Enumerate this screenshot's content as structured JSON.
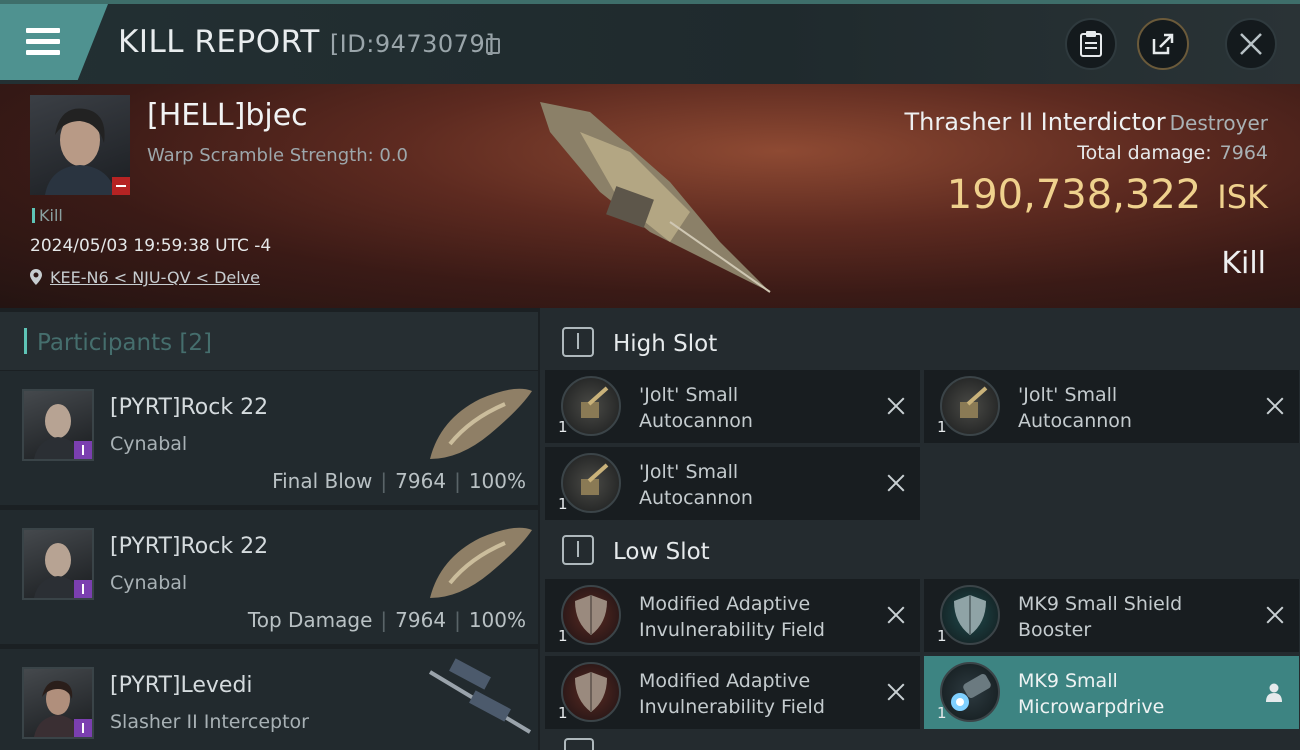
{
  "header": {
    "title": "KILL REPORT",
    "report_id": "[ID:9473079]"
  },
  "victim": {
    "name": "[HELL]bjec",
    "scramble": "Warp Scramble Strength: 0.0",
    "tag": "Kill",
    "datetime": "2024/05/03 19:59:38 UTC -4",
    "location": "KEE-N6 < NJU-QV < Delve",
    "ship_name": "Thrasher II Interdictor",
    "ship_class": "Destroyer",
    "total_damage_label": "Total damage:",
    "total_damage": "7964",
    "isk_value": "190,738,322",
    "isk_unit": "ISK",
    "result": "Kill"
  },
  "participants": {
    "label": "Participants",
    "count": "[2]",
    "rows": [
      {
        "name": "[PYRT]Rock 22",
        "ship": "Cynabal",
        "role": "Final Blow",
        "damage": "7964",
        "percent": "100%"
      },
      {
        "name": "[PYRT]Rock 22",
        "ship": "Cynabal",
        "role": "Top Damage",
        "damage": "7964",
        "percent": "100%"
      },
      {
        "name": "[PYRT]Levedi",
        "ship": "Slasher II Interceptor"
      }
    ]
  },
  "slots": {
    "high": {
      "title": "High Slot",
      "items": [
        {
          "line1": "'Jolt' Small",
          "line2": "Autocannon",
          "qty": "1"
        },
        {
          "line1": "'Jolt' Small",
          "line2": "Autocannon",
          "qty": "1"
        },
        {
          "line1": "'Jolt' Small",
          "line2": "Autocannon",
          "qty": "1"
        }
      ]
    },
    "low": {
      "title": "Low Slot",
      "items": [
        {
          "line1": "Modified Adaptive",
          "line2": "Invulnerability Field",
          "qty": "1"
        },
        {
          "line1": "MK9 Small Shield",
          "line2": "Booster",
          "qty": "1"
        },
        {
          "line1": "Modified Adaptive",
          "line2": "Invulnerability Field",
          "qty": "1"
        },
        {
          "line1": "MK9 Small",
          "line2": "Microwarpdrive",
          "qty": "1"
        }
      ]
    }
  },
  "colors": {
    "accent": "#5ec4b6",
    "isk": "#efd18d",
    "highlight": "#3d8482"
  }
}
